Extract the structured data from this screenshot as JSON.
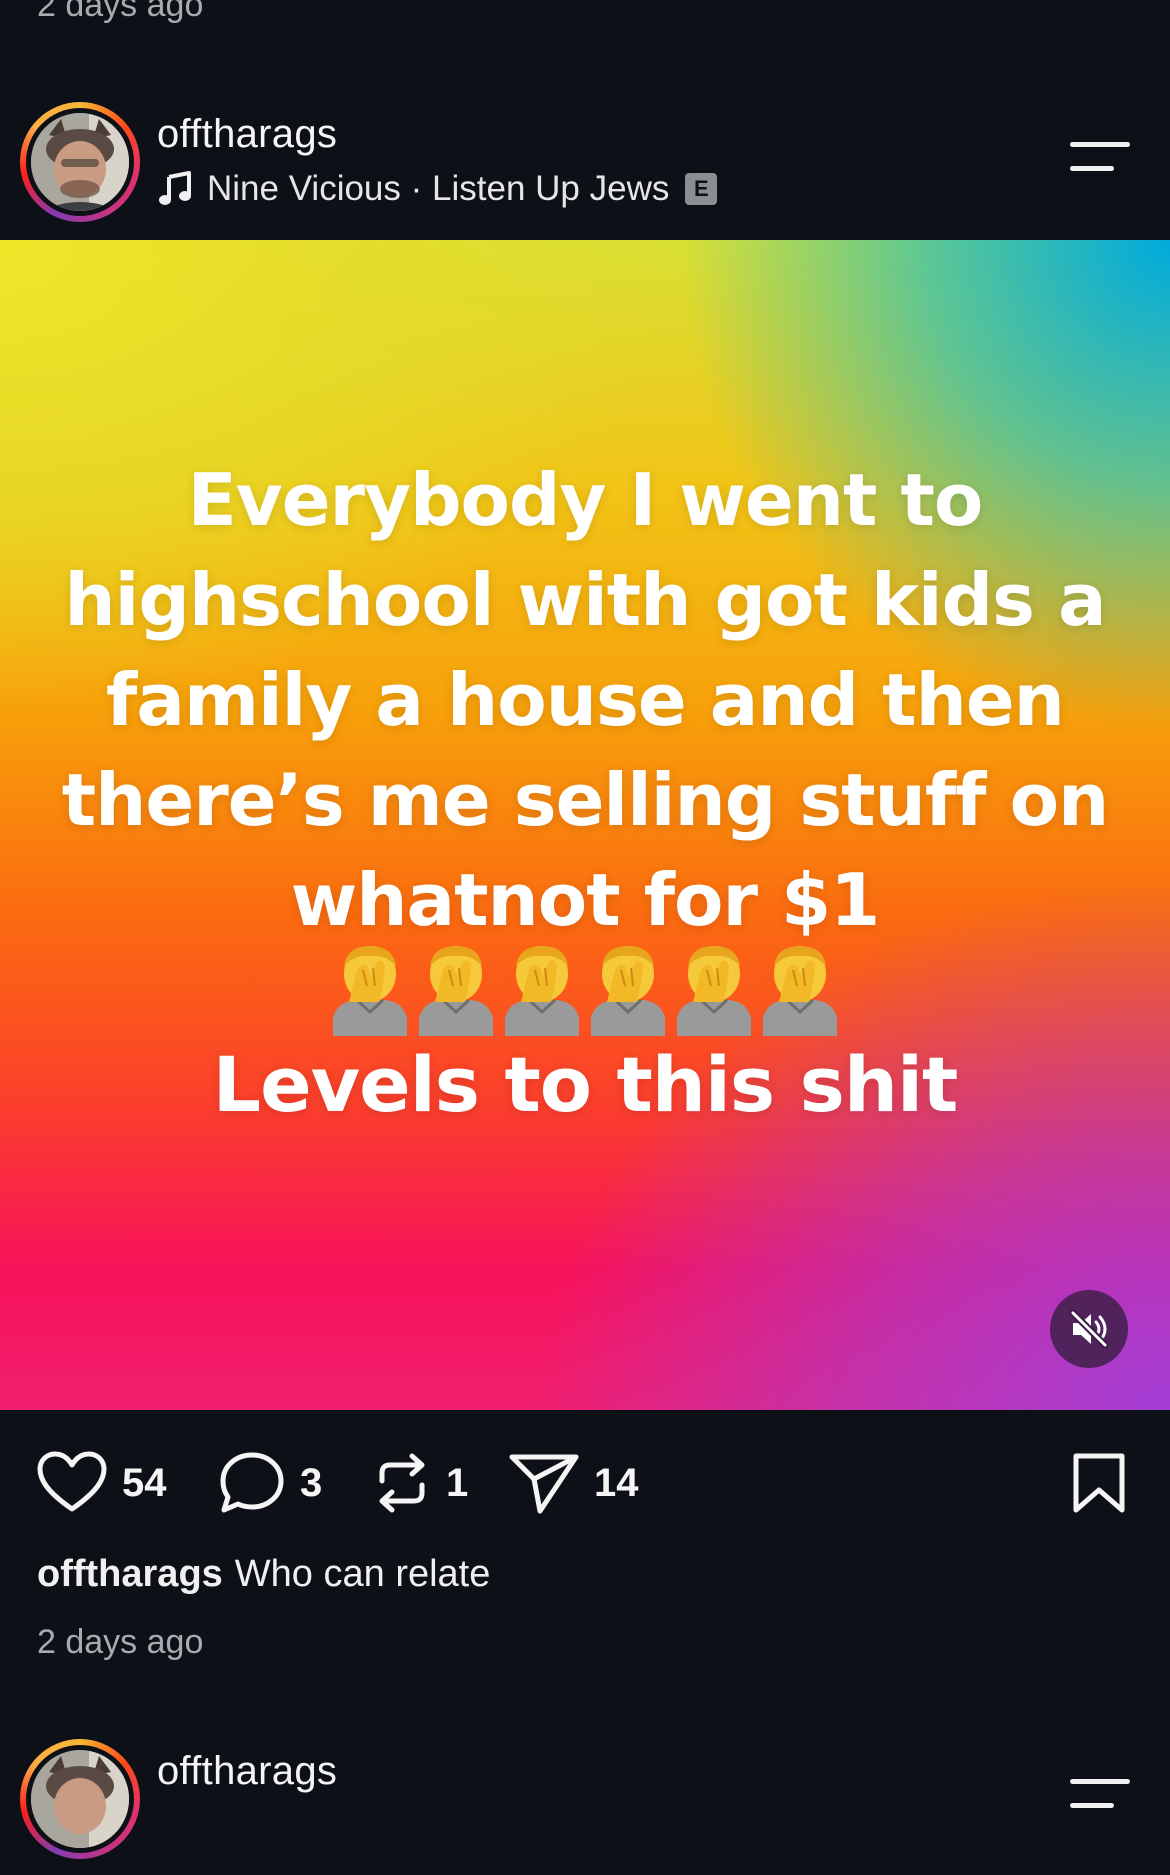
{
  "previous_post": {
    "time": "2 days ago"
  },
  "post": {
    "username": "offtharags",
    "music": {
      "artist": "Nine Vicious",
      "separator": " · ",
      "song": "Listen Up Jews",
      "explicit_badge": "E"
    },
    "media": {
      "text_line1": "Everybody I went to highschool with got kids a family a house and then there’s me selling stuff on whatnot for $1",
      "emoji_count": 6,
      "emoji": "facepalm",
      "text_line2": "Levels to this shit",
      "mute_icon": "speaker-muted-icon"
    },
    "actions": {
      "likes": "54",
      "comments": "3",
      "reposts": "1",
      "shares": "14"
    },
    "caption": {
      "user": "offtharags",
      "text": "Who can relate"
    },
    "time": "2 days ago"
  },
  "next_post": {
    "username": "offtharags"
  },
  "colors": {
    "background": "#0d1117",
    "secondary_text": "#a8abb0",
    "primary_text": "#f5f5f5"
  }
}
